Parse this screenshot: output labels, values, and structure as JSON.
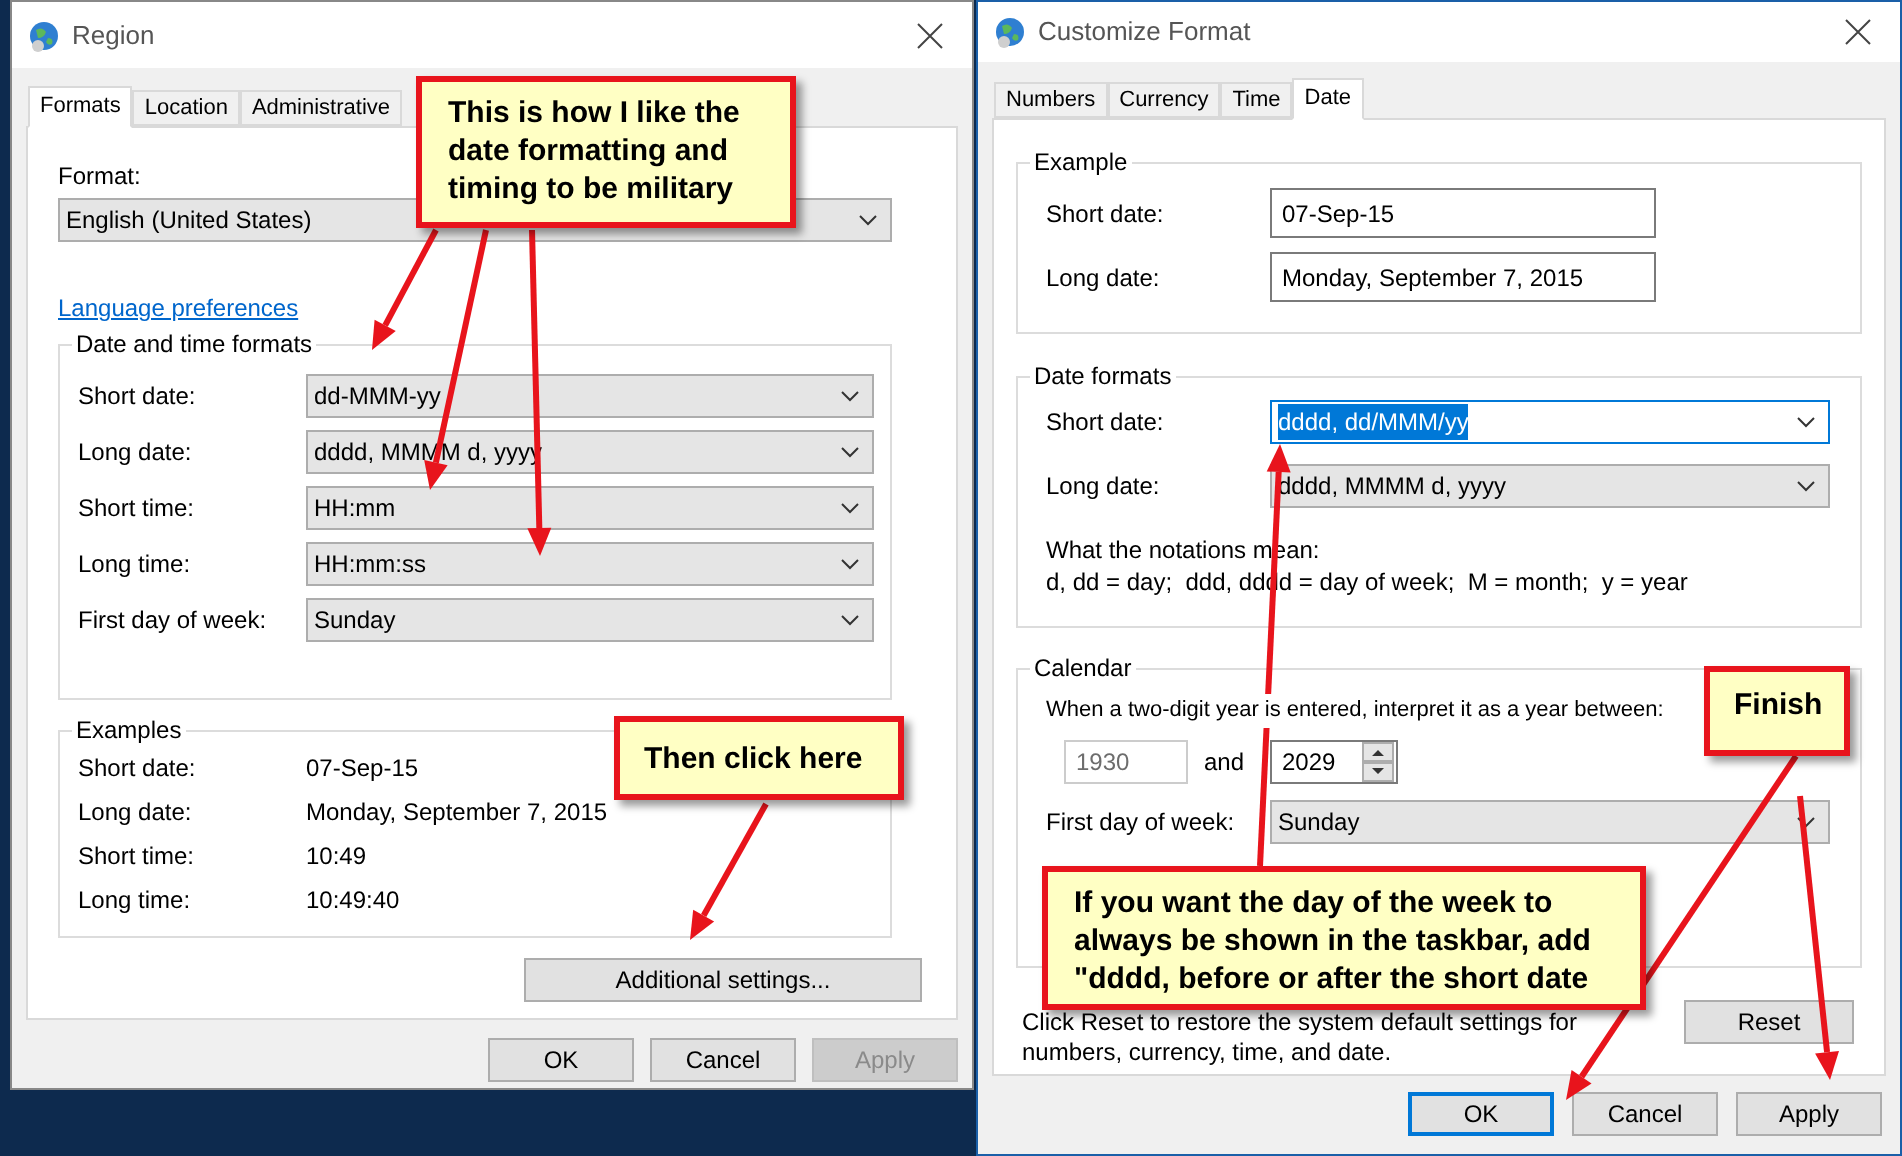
{
  "region_window": {
    "title": "Region",
    "tabs": [
      {
        "label": "Formats",
        "selected": true
      },
      {
        "label": "Location",
        "selected": false
      },
      {
        "label": "Administrative",
        "selected": false
      }
    ],
    "format_label": "Format:",
    "format_value": "English (United States)",
    "language_link": "Language preferences",
    "date_time_formats": {
      "title": "Date and time formats",
      "rows": [
        {
          "label": "Short date:",
          "value": "dd-MMM-yy"
        },
        {
          "label": "Long date:",
          "value": "dddd, MMMM d, yyyy"
        },
        {
          "label": "Short time:",
          "value": "HH:mm"
        },
        {
          "label": "Long time:",
          "value": "HH:mm:ss"
        },
        {
          "label": "First day of week:",
          "value": "Sunday"
        }
      ]
    },
    "examples": {
      "title": "Examples",
      "rows": [
        {
          "label": "Short date:",
          "value": "07-Sep-15"
        },
        {
          "label": "Long date:",
          "value": "Monday, September 7, 2015"
        },
        {
          "label": "Short time:",
          "value": "10:49"
        },
        {
          "label": "Long time:",
          "value": "10:49:40"
        }
      ]
    },
    "additional_button": "Additional settings...",
    "buttons": [
      {
        "label": "OK",
        "disabled": false
      },
      {
        "label": "Cancel",
        "disabled": false
      },
      {
        "label": "Apply",
        "disabled": true
      }
    ]
  },
  "customize_window": {
    "title": "Customize Format",
    "tabs": [
      {
        "label": "Numbers",
        "selected": false
      },
      {
        "label": "Currency",
        "selected": false
      },
      {
        "label": "Time",
        "selected": false
      },
      {
        "label": "Date",
        "selected": true
      }
    ],
    "example": {
      "title": "Example",
      "rows": [
        {
          "label": "Short date:",
          "value": "07-Sep-15"
        },
        {
          "label": "Long date:",
          "value": "Monday, September 7, 2015"
        }
      ]
    },
    "date_formats": {
      "title": "Date formats",
      "rows": [
        {
          "label": "Short date:",
          "value": "dddd, dd/MMM/yy",
          "focused": true
        },
        {
          "label": "Long date:",
          "value": "dddd, MMMM d, yyyy",
          "focused": false
        }
      ],
      "notation_title": "What the notations mean:",
      "notation_text": "d, dd = day;  ddd, dddd = day of week;  M = month;  y = year"
    },
    "calendar": {
      "title": "Calendar",
      "prompt": "When a two-digit year is entered, interpret it as a year between:",
      "from_year": {
        "value": "1930",
        "disabled": true
      },
      "and_label": "and",
      "to_year": {
        "value": "2029",
        "disabled": false
      },
      "first_day_label": "First day of week:",
      "first_day_value": "Sunday"
    },
    "reset_note": "Click Reset to restore the system default settings for numbers, currency, time, and date.",
    "reset_button": "Reset",
    "buttons": [
      {
        "label": "OK",
        "default": true
      },
      {
        "label": "Cancel",
        "default": false
      },
      {
        "label": "Apply",
        "default": false
      }
    ]
  },
  "callouts": [
    {
      "text": "This is how I like the date formatting and timing to be military"
    },
    {
      "text": "Then click here"
    },
    {
      "text": "If you want the day of the week to always be shown in the taskbar, add \"dddd, before or after the short  date"
    },
    {
      "text": "Finish"
    }
  ]
}
